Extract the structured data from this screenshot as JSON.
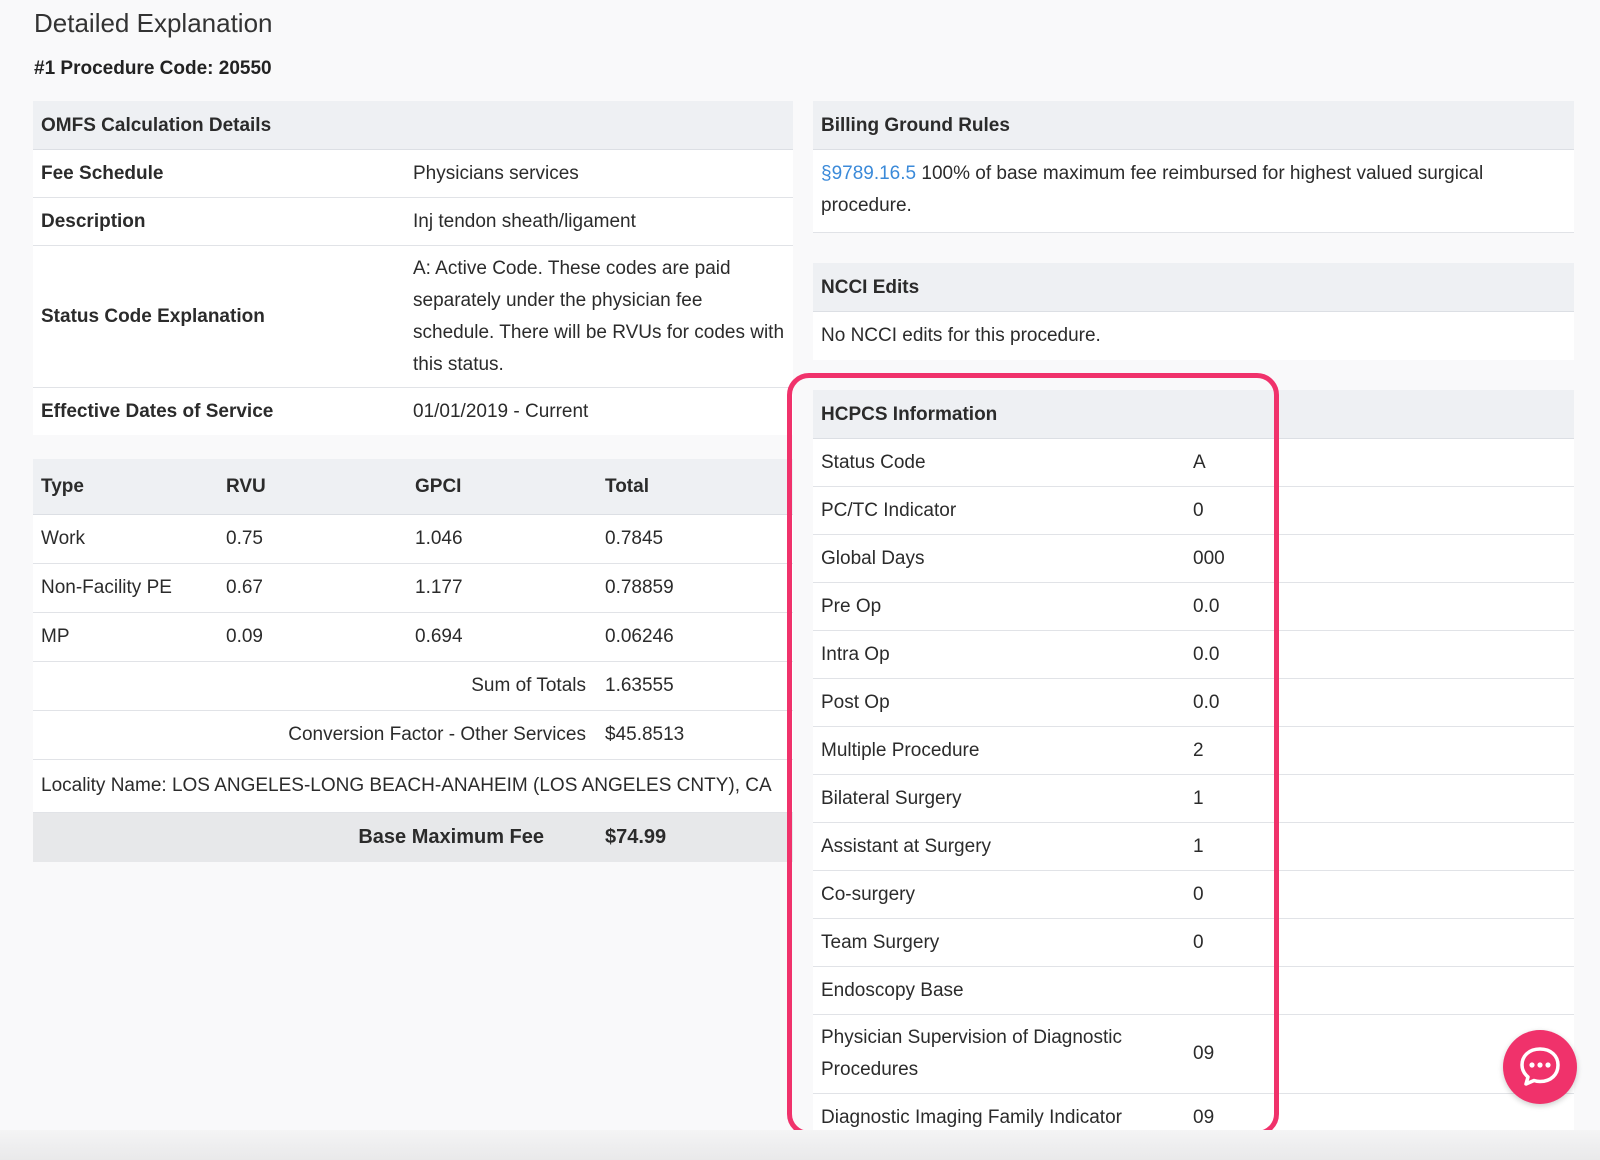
{
  "page": {
    "title": "Detailed Explanation",
    "procedure_code": "#1 Procedure Code: 20550"
  },
  "omfs": {
    "header": "OMFS Calculation Details",
    "rows": [
      {
        "label": "Fee Schedule",
        "value": "Physicians services"
      },
      {
        "label": "Description",
        "value": "Inj tendon sheath/ligament"
      },
      {
        "label": "Status Code Explanation",
        "value": "A: Active Code. These codes are paid separately under the physician fee schedule. There will be RVUs for codes with this status."
      },
      {
        "label": "Effective Dates of Service",
        "value": "01/01/2019 - Current"
      }
    ]
  },
  "rvu_table": {
    "columns": [
      "Type",
      "RVU",
      "GPCI",
      "Total"
    ],
    "rows": [
      [
        "Work",
        "0.75",
        "1.046",
        "0.7845"
      ],
      [
        "Non-Facility PE",
        "0.67",
        "1.177",
        "0.78859"
      ],
      [
        "MP",
        "0.09",
        "0.694",
        "0.06246"
      ]
    ],
    "sum_label": "Sum of Totals",
    "sum_value": "1.63555",
    "cf_label": "Conversion Factor - Other Services",
    "cf_value": "$45.8513",
    "locality": "Locality Name: LOS ANGELES-LONG BEACH-ANAHEIM (LOS ANGELES CNTY), CA",
    "base_label": "Base Maximum Fee",
    "base_value": "$74.99"
  },
  "billing": {
    "header": "Billing Ground Rules",
    "link": "§9789.16.5",
    "text": " 100% of base maximum fee reimbursed for highest valued surgical procedure."
  },
  "ncci": {
    "header": "NCCI Edits",
    "text": "No NCCI edits for this procedure."
  },
  "hcpcs": {
    "header": "HCPCS Information",
    "rows": [
      {
        "label": "Status Code",
        "value": "A"
      },
      {
        "label": "PC/TC Indicator",
        "value": "0"
      },
      {
        "label": "Global Days",
        "value": "000"
      },
      {
        "label": "Pre Op",
        "value": "0.0"
      },
      {
        "label": "Intra Op",
        "value": "0.0"
      },
      {
        "label": "Post Op",
        "value": "0.0"
      },
      {
        "label": "Multiple Procedure",
        "value": "2"
      },
      {
        "label": "Bilateral Surgery",
        "value": "1"
      },
      {
        "label": "Assistant at Surgery",
        "value": "1"
      },
      {
        "label": "Co-surgery",
        "value": "0"
      },
      {
        "label": "Team Surgery",
        "value": "0"
      },
      {
        "label": "Endoscopy Base",
        "value": ""
      },
      {
        "label": "Physician Supervision of Diagnostic Procedures",
        "value": "09"
      },
      {
        "label": "Diagnostic Imaging Family Indicator",
        "value": "09"
      }
    ]
  },
  "colors": {
    "accent": "#f0326b",
    "link": "#3b8ad9"
  },
  "icons": {
    "chat": "chat-bubble-icon"
  }
}
